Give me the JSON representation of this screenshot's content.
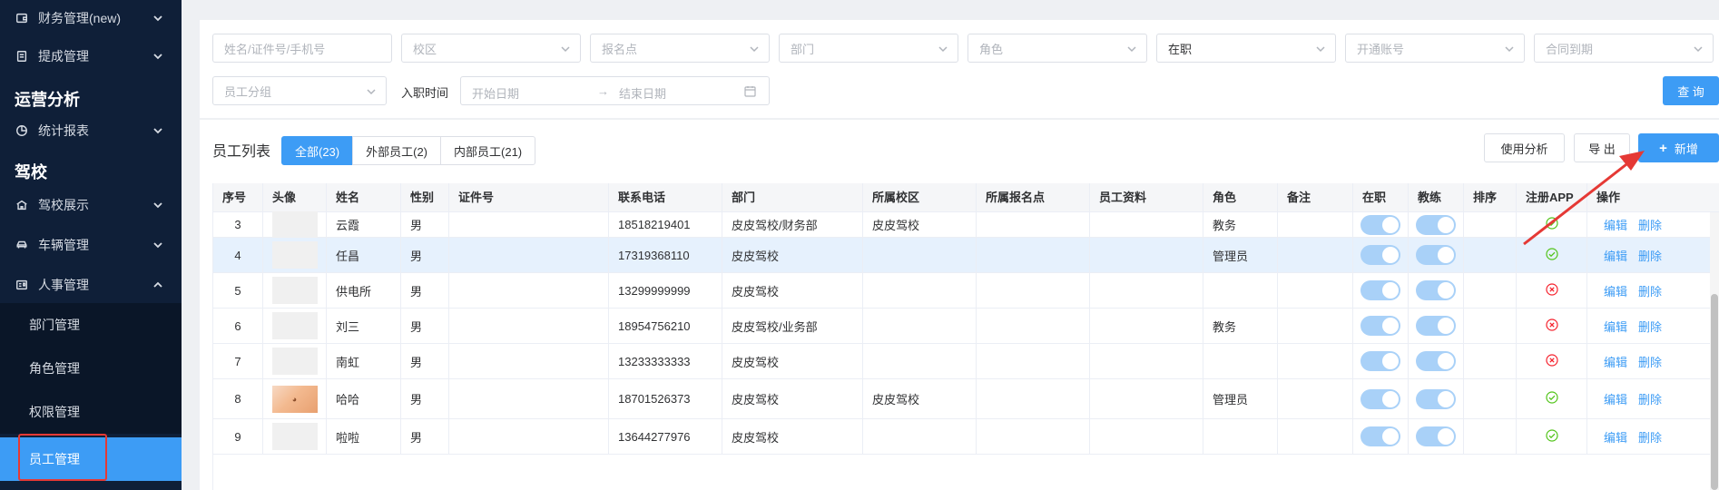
{
  "sidebar": {
    "items_top": [
      {
        "label": "财务管理(new)",
        "icon": "wallet-icon"
      },
      {
        "label": "提成管理",
        "icon": "document-icon"
      }
    ],
    "group_ops": "运营分析",
    "ops_items": [
      {
        "label": "统计报表",
        "icon": "pie-chart-icon"
      }
    ],
    "group_school": "驾校",
    "school_items": [
      {
        "label": "驾校展示",
        "icon": "school-icon"
      },
      {
        "label": "车辆管理",
        "icon": "car-icon"
      },
      {
        "label": "人事管理",
        "icon": "id-card-icon"
      }
    ],
    "hr_subitems": [
      {
        "label": "部门管理"
      },
      {
        "label": "角色管理"
      },
      {
        "label": "权限管理"
      },
      {
        "label": "员工管理"
      }
    ]
  },
  "filters": {
    "name_placeholder": "姓名/证件号/手机号",
    "campus_placeholder": "校区",
    "signup_point_placeholder": "报名点",
    "department_placeholder": "部门",
    "role_placeholder": "角色",
    "status_value": "在职",
    "account_placeholder": "开通账号",
    "contract_placeholder": "合同到期",
    "group_placeholder": "员工分组",
    "hire_date_label": "入职时间",
    "start_date_placeholder": "开始日期",
    "range_separator": "→",
    "end_date_placeholder": "结束日期",
    "query_button": "查 询"
  },
  "list": {
    "title": "员工列表",
    "tabs": [
      {
        "label": "全部(23)",
        "active": true
      },
      {
        "label": "外部员工(2)",
        "active": false
      },
      {
        "label": "内部员工(21)",
        "active": false
      }
    ],
    "usage_button": "使用分析",
    "export_button": "导 出",
    "add_button": "新增"
  },
  "table": {
    "columns": [
      "序号",
      "头像",
      "姓名",
      "性别",
      "证件号",
      "联系电话",
      "部门",
      "所属校区",
      "所属报名点",
      "员工资料",
      "角色",
      "备注",
      "在职",
      "教练",
      "排序",
      "注册APP",
      "操作"
    ],
    "op_edit": "编辑",
    "op_delete": "删除",
    "rows": [
      {
        "no": "3",
        "name": "云霞",
        "gender": "男",
        "id_no": "",
        "phone": "18518219401",
        "dept": "皮皮驾校/财务部",
        "campus": "皮皮驾校",
        "signup_point": "",
        "profile": "",
        "role": "教务",
        "remark": "",
        "on_job": true,
        "coach": true,
        "sort": "",
        "registered": true,
        "photo": false
      },
      {
        "no": "4",
        "name": "任昌",
        "gender": "男",
        "id_no": "",
        "phone": "17319368110",
        "dept": "皮皮驾校",
        "campus": "",
        "signup_point": "",
        "profile": "",
        "role": "管理员",
        "remark": "",
        "on_job": true,
        "coach": true,
        "sort": "",
        "registered": true,
        "photo": false
      },
      {
        "no": "5",
        "name": "供电所",
        "gender": "男",
        "id_no": "",
        "phone": "13299999999",
        "dept": "皮皮驾校",
        "campus": "",
        "signup_point": "",
        "profile": "",
        "role": "",
        "remark": "",
        "on_job": true,
        "coach": true,
        "sort": "",
        "registered": false,
        "photo": false
      },
      {
        "no": "6",
        "name": "刘三",
        "gender": "男",
        "id_no": "",
        "phone": "18954756210",
        "dept": "皮皮驾校/业务部",
        "campus": "",
        "signup_point": "",
        "profile": "",
        "role": "教务",
        "remark": "",
        "on_job": true,
        "coach": true,
        "sort": "",
        "registered": false,
        "photo": false
      },
      {
        "no": "7",
        "name": "南虹",
        "gender": "男",
        "id_no": "",
        "phone": "13233333333",
        "dept": "皮皮驾校",
        "campus": "",
        "signup_point": "",
        "profile": "",
        "role": "",
        "remark": "",
        "on_job": true,
        "coach": true,
        "sort": "",
        "registered": false,
        "photo": false
      },
      {
        "no": "8",
        "name": "哈哈",
        "gender": "男",
        "id_no": "",
        "phone": "18701526373",
        "dept": "皮皮驾校",
        "campus": "皮皮驾校",
        "signup_point": "",
        "profile": "",
        "role": "管理员",
        "remark": "",
        "on_job": true,
        "coach": true,
        "sort": "",
        "registered": true,
        "photo": true
      },
      {
        "no": "9",
        "name": "啦啦",
        "gender": "男",
        "id_no": "",
        "phone": "13644277976",
        "dept": "皮皮驾校",
        "campus": "",
        "signup_point": "",
        "profile": "",
        "role": "",
        "remark": "",
        "on_job": true,
        "coach": true,
        "sort": "",
        "registered": true,
        "photo": false
      }
    ]
  },
  "colors": {
    "sidebar_bg": "#0f1f38",
    "accent": "#3d9cf5",
    "success": "#52c41a",
    "danger": "#f5222d",
    "annotation": "#e53935"
  }
}
